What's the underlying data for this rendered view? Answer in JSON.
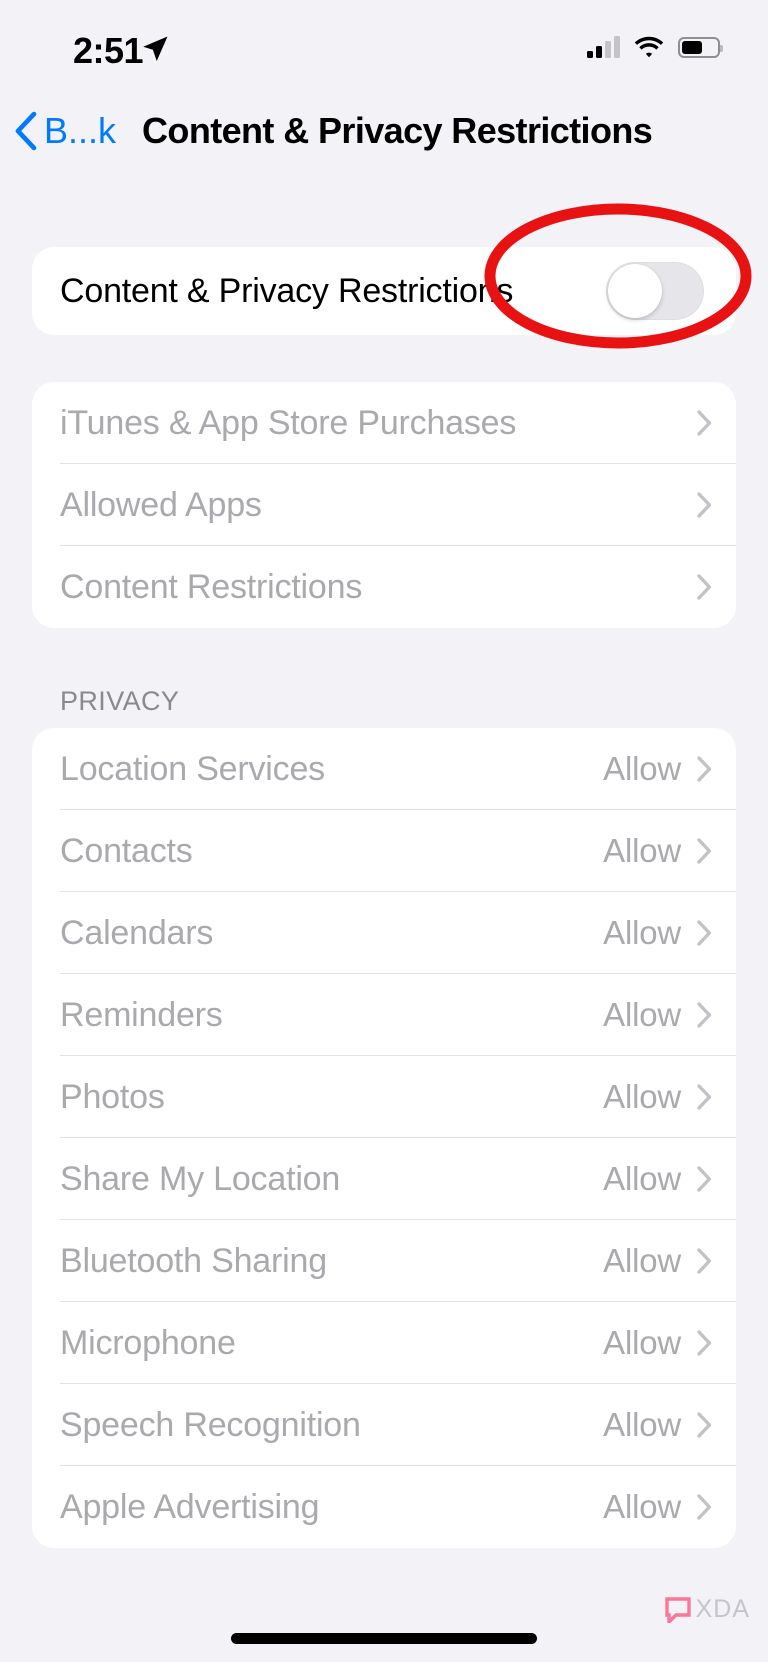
{
  "status_bar": {
    "time": "2:51",
    "location_icon": "location-arrow-icon",
    "signal_icon": "cellular-signal-icon",
    "signal_bars_filled": 2,
    "signal_bars_total": 4,
    "wifi_icon": "wifi-icon",
    "battery_icon": "battery-icon",
    "battery_level_percent": 53
  },
  "nav_bar": {
    "back_label": "B...k",
    "back_icon": "chevron-left-icon",
    "title": "Content & Privacy Restrictions"
  },
  "toggle_section": {
    "label": "Content & Privacy Restrictions",
    "toggle_state": "off",
    "toggle_name": "content-privacy-restrictions-toggle"
  },
  "annotation": {
    "type": "ellipse-highlight",
    "color": "#e81212",
    "target": "content-privacy-restrictions-toggle"
  },
  "restrictions_group": {
    "rows": [
      {
        "label": "iTunes & App Store Purchases",
        "value": "",
        "disabled": true
      },
      {
        "label": "Allowed Apps",
        "value": "",
        "disabled": true
      },
      {
        "label": "Content Restrictions",
        "value": "",
        "disabled": true
      }
    ]
  },
  "privacy_section": {
    "header": "PRIVACY",
    "rows": [
      {
        "label": "Location Services",
        "value": "Allow",
        "disabled": true
      },
      {
        "label": "Contacts",
        "value": "Allow",
        "disabled": true
      },
      {
        "label": "Calendars",
        "value": "Allow",
        "disabled": true
      },
      {
        "label": "Reminders",
        "value": "Allow",
        "disabled": true
      },
      {
        "label": "Photos",
        "value": "Allow",
        "disabled": true
      },
      {
        "label": "Share My Location",
        "value": "Allow",
        "disabled": true
      },
      {
        "label": "Bluetooth Sharing",
        "value": "Allow",
        "disabled": true
      },
      {
        "label": "Microphone",
        "value": "Allow",
        "disabled": true
      },
      {
        "label": "Speech Recognition",
        "value": "Allow",
        "disabled": true
      },
      {
        "label": "Apple Advertising",
        "value": "Allow",
        "disabled": true
      }
    ]
  },
  "watermark": {
    "text": "XDA",
    "icon": "xda-logo-icon",
    "icon_color": "#ff4d7a"
  },
  "colors": {
    "page_background": "#f2f2f7",
    "card_background": "#ffffff",
    "accent_blue": "#007aff",
    "disabled_text": "#a9a9ae",
    "separator": "#e3e3e6",
    "annotation_red": "#e81212"
  },
  "home_indicator": "home-indicator"
}
